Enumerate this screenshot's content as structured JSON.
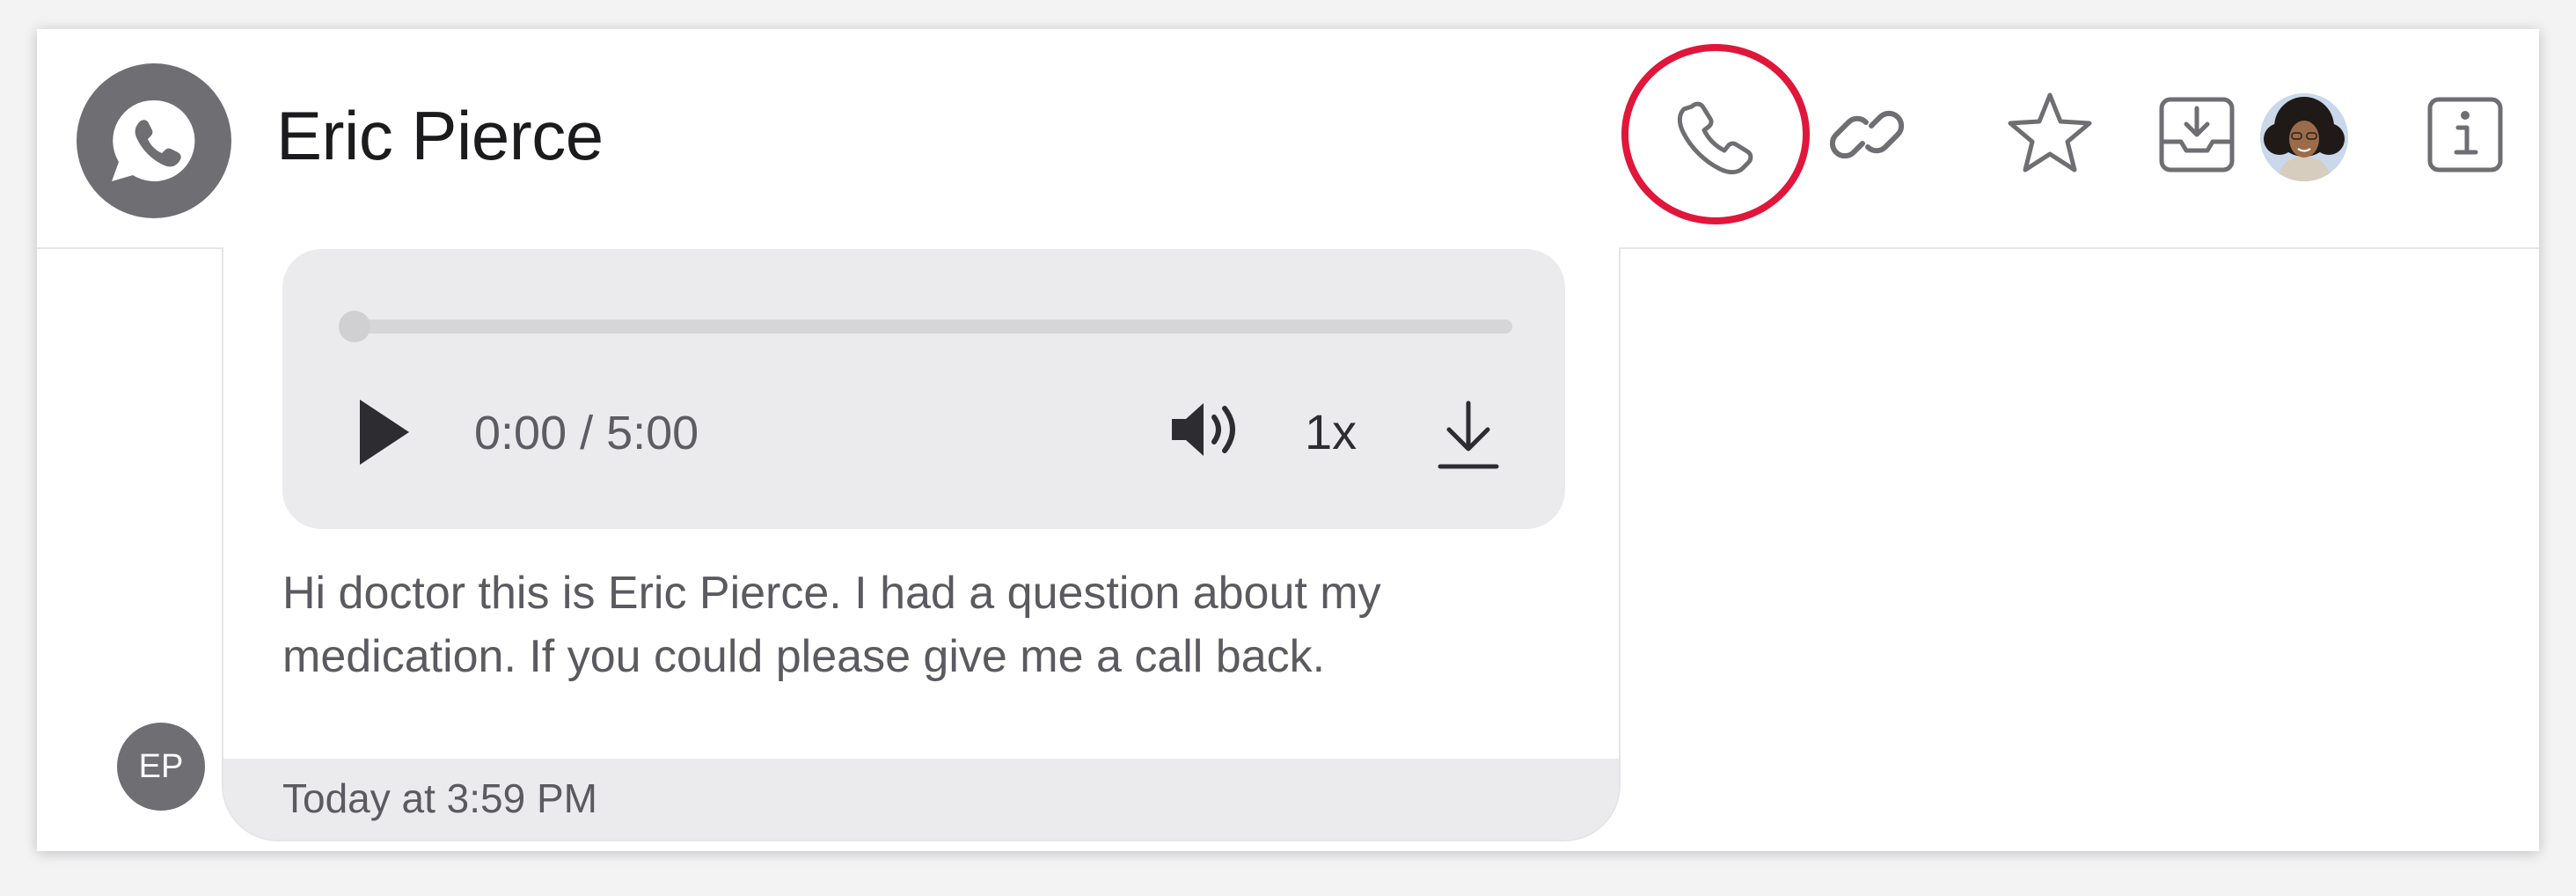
{
  "header": {
    "title": "Eric Pierce",
    "channel_icon": "whatsapp-icon",
    "actions": [
      {
        "name": "call",
        "icon": "phone-icon",
        "highlighted": true
      },
      {
        "name": "link",
        "icon": "link-icon"
      },
      {
        "name": "star",
        "icon": "star-icon"
      },
      {
        "name": "archive",
        "icon": "inbox-download-icon"
      },
      {
        "name": "assignee",
        "icon": "avatar"
      },
      {
        "name": "info",
        "icon": "info-icon"
      }
    ],
    "highlight_color": "#e0163b"
  },
  "voicemail": {
    "progress": 0,
    "time": "0:00 / 5:00",
    "speed": "1x",
    "transcript": "Hi doctor this is Eric Pierce. I had a question about my medication. If you could please give me a call back.",
    "timestamp": "Today at 3:59 PM",
    "sender_initials": "EP"
  }
}
